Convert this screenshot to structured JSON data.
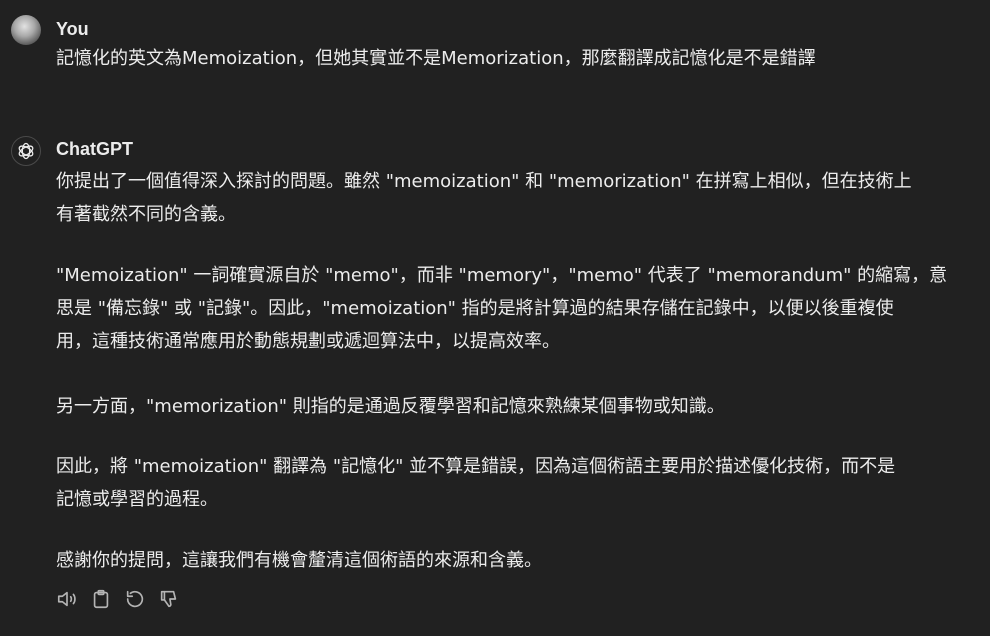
{
  "user_message": {
    "author": "You",
    "text": "記憶化的英文為Memoization，但她其實並不是Memorization，那麼翻譯成記憶化是不是錯譯"
  },
  "assistant_message": {
    "author": "ChatGPT",
    "paragraphs": [
      [
        "你提出了一個值得深入探討的問題。雖然 \"memoization\" 和 \"memorization\" 在拼寫上相似，但在技術上",
        "有著截然不同的含義。"
      ],
      [
        "\"Memoization\" 一詞確實源自於 \"memo\"，而非 \"memory\"，\"memo\" 代表了 \"memorandum\" 的縮寫，意",
        "思是 \"備忘錄\" 或 \"記錄\"。因此，\"memoization\" 指的是將計算過的結果存儲在記錄中，以便以後重複使",
        "用，這種技術通常應用於動態規劃或遞迴算法中，以提高效率。"
      ],
      [
        "另一方面，\"memorization\" 則指的是通過反覆學習和記憶來熟練某個事物或知識。"
      ],
      [
        "因此，將 \"memoization\" 翻譯為 \"記憶化\" 並不算是錯誤，因為這個術語主要用於描述優化技術，而不是",
        "記憶或學習的過程。"
      ],
      [
        "感謝你的提問，這讓我們有機會釐清這個術語的來源和含義。"
      ]
    ]
  },
  "actions": [
    {
      "icon": "speaker-icon"
    },
    {
      "icon": "clipboard-icon"
    },
    {
      "icon": "regenerate-icon"
    },
    {
      "icon": "thumbs-down-icon"
    }
  ]
}
